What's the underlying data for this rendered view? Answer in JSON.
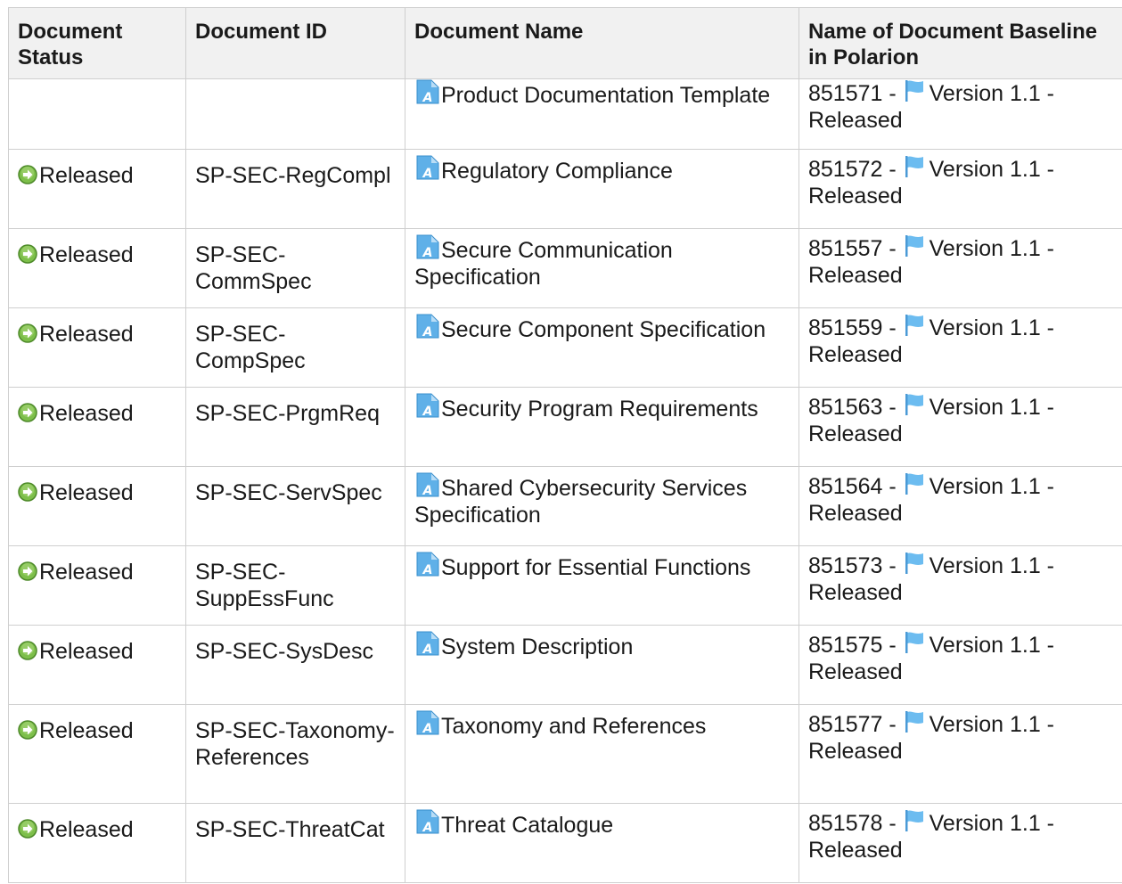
{
  "colors": {
    "header_bg": "#f1f1f1",
    "border": "#cfcfcf",
    "status_green": "#6cb33f",
    "doc_blue": "#4aa3df",
    "flag_blue": "#5aaee6"
  },
  "headers": {
    "status": "Document Status",
    "id": "Document ID",
    "name": "Document Name",
    "baseline": "Name of Document Baseline in Polarion"
  },
  "icons": {
    "status": "released-status-icon",
    "document": "document-icon",
    "baseline": "baseline-flag-icon"
  },
  "rows": [
    {
      "status": "",
      "id": "",
      "name": "Product Documentation Template",
      "baseline_id": "851571 - ",
      "baseline_name": "Version 1.1 - Released"
    },
    {
      "status": "Released",
      "id": "SP-SEC-RegCompl",
      "name": "Regulatory Compliance",
      "baseline_id": "851572 - ",
      "baseline_name": "Version 1.1 - Released"
    },
    {
      "status": "Released",
      "id": "SP-SEC-CommSpec",
      "name": "Secure Communication Specification",
      "baseline_id": "851557 - ",
      "baseline_name": "Version 1.1 - Released"
    },
    {
      "status": "Released",
      "id": "SP-SEC-CompSpec",
      "name": "Secure Component Specification",
      "baseline_id": "851559 - ",
      "baseline_name": "Version 1.1 - Released"
    },
    {
      "status": "Released",
      "id": "SP-SEC-PrgmReq",
      "name": "Security Program Requirements",
      "baseline_id": "851563 - ",
      "baseline_name": "Version 1.1 - Released"
    },
    {
      "status": "Released",
      "id": "SP-SEC-ServSpec",
      "name": "Shared Cybersecurity Services Specification",
      "baseline_id": "851564 - ",
      "baseline_name": "Version 1.1 - Released"
    },
    {
      "status": "Released",
      "id": "SP-SEC-SuppEssFunc",
      "name": "Support for Essential Functions",
      "baseline_id": "851573 - ",
      "baseline_name": "Version 1.1 - Released"
    },
    {
      "status": "Released",
      "id": "SP-SEC-SysDesc",
      "name": "System Description",
      "baseline_id": "851575 - ",
      "baseline_name": "Version 1.1 - Released"
    },
    {
      "status": "Released",
      "id": "SP-SEC-Taxonomy-References",
      "name": "Taxonomy and References",
      "baseline_id": "851577 - ",
      "baseline_name": "Version 1.1 - Released"
    },
    {
      "status": "Released",
      "id": "SP-SEC-ThreatCat",
      "name": "Threat Catalogue",
      "baseline_id": "851578 - ",
      "baseline_name": "Version 1.1 - Released"
    }
  ]
}
